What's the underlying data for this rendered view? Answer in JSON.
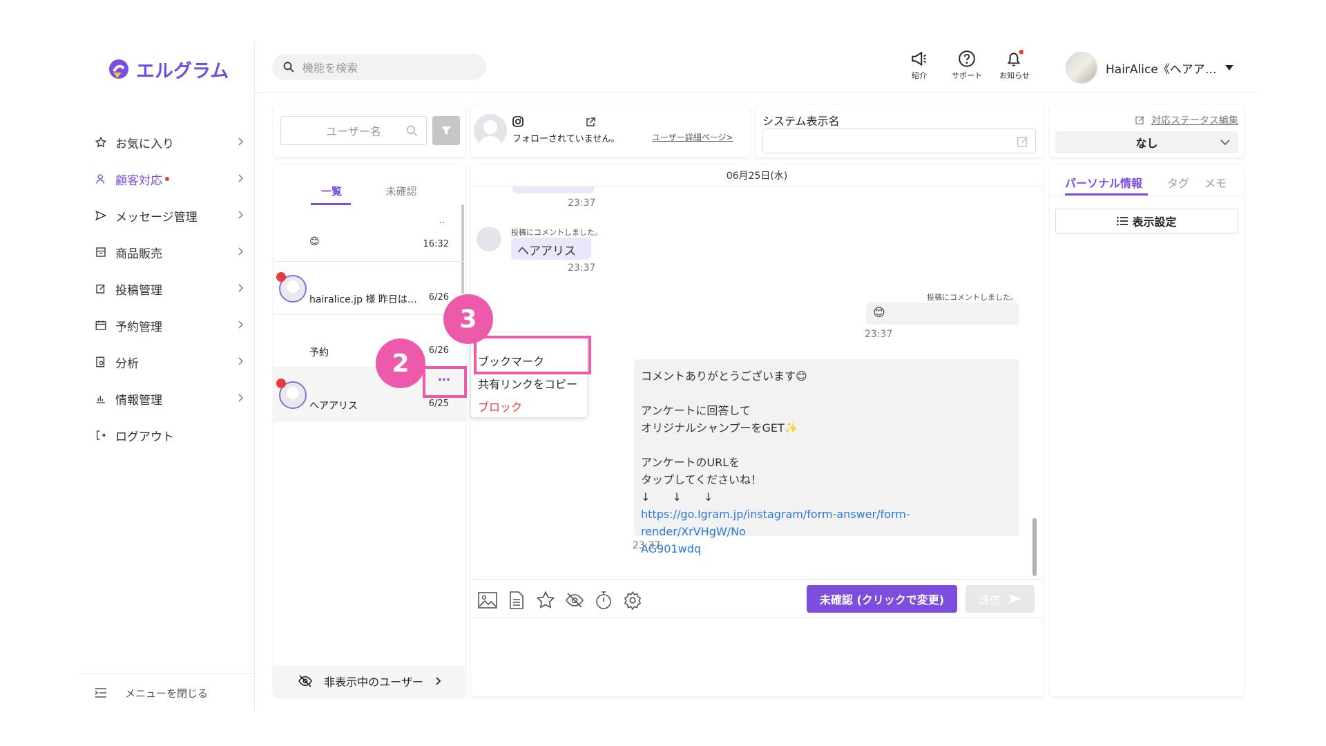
{
  "brand": {
    "name": "エルグラム"
  },
  "search": {
    "placeholder": "機能を検索"
  },
  "sidebar": {
    "items": [
      {
        "label": "お気に入り",
        "icon": "star-icon"
      },
      {
        "label": "顧客対応",
        "icon": "person-icon",
        "active": true,
        "badge": true
      },
      {
        "label": "メッセージ管理",
        "icon": "send-icon"
      },
      {
        "label": "商品販売",
        "icon": "store-icon"
      },
      {
        "label": "投稿管理",
        "icon": "edit-icon"
      },
      {
        "label": "予約管理",
        "icon": "calendar-icon"
      },
      {
        "label": "分析",
        "icon": "chart-search-icon"
      },
      {
        "label": "情報管理",
        "icon": "bar-chart-icon"
      },
      {
        "label": "ログアウト",
        "icon": "logout-icon"
      }
    ],
    "collapse_label": "メニューを閉じる"
  },
  "header": {
    "intro": "紹介",
    "support": "サポート",
    "notifications": "お知らせ",
    "user_name": "HairAlice《ヘアア…"
  },
  "list": {
    "search_placeholder": "ユーザー名",
    "tab_all": "一覧",
    "tab_unread": "未確認",
    "rows": [
      {
        "name": "😊",
        "time": "16:32",
        "extra": "‥"
      },
      {
        "name": "hairalice.jp 様 昨日は…",
        "time": "6/26"
      },
      {
        "name": "予約",
        "time": "6/26"
      },
      {
        "name": "ヘアアリス",
        "time": "6/25",
        "more": "…"
      }
    ],
    "hidden_users": "非表示中のユーザー"
  },
  "profile": {
    "follow_status": "フォローされていません。",
    "detail_link": "ユーザー詳細ページ>"
  },
  "system_name": {
    "label": "システム表示名",
    "value": ""
  },
  "status": {
    "edit_label": "対応ステータス編集",
    "value": "なし"
  },
  "chat": {
    "date": "06月25日(水)",
    "messages": [
      {
        "time": "23:37"
      },
      {
        "note": "投稿にコメントしました。",
        "text": "ヘアアリス",
        "time": "23:37"
      },
      {
        "note": "投稿にコメントしました。",
        "text": "😊",
        "time": "23:37"
      },
      {
        "lines": [
          "コメントありがとうございます😊",
          "",
          "アンケートに回答して",
          "オリジナルシャンプーをGET✨",
          "",
          "アンケートのURLを",
          "タップしてくださいね！",
          "↓　　↓　　↓"
        ],
        "link1": "https://go.lgram.jp/instagram/form-answer/form-render/XrVHgW/No",
        "link2": "AG901wdq",
        "time": "23:37"
      }
    ],
    "unread_button": "未確認 (クリックで変更)",
    "send_button": "送信"
  },
  "context_menu": {
    "items": [
      "ブックマーク",
      "共有リンクをコピー",
      "ブロック"
    ]
  },
  "annotations": {
    "step2": "2",
    "step3": "3"
  },
  "right_panel": {
    "tabs": [
      "パーソナル情報",
      "タグ",
      "メモ"
    ],
    "display_settings": "表示設定"
  },
  "colors": {
    "accent": "#7c4dde",
    "annotation": "#ec5aa9",
    "danger": "#e53d3d",
    "link": "#2a7bd8"
  }
}
